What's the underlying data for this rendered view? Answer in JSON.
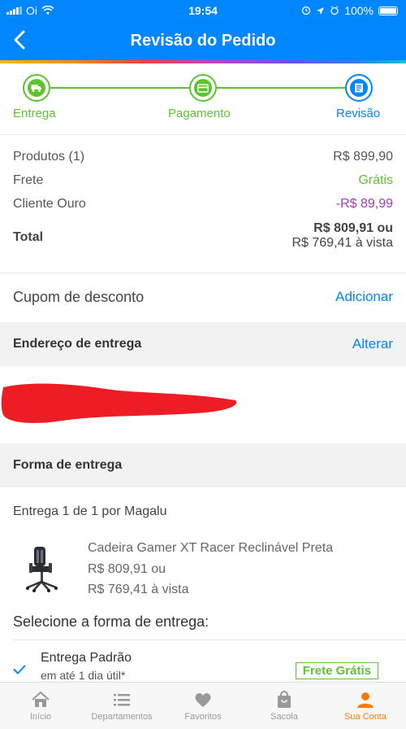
{
  "status_bar": {
    "carrier": "Oi",
    "time": "19:54",
    "battery": "100%",
    "signal_icon": "signal-bars-icon",
    "wifi_icon": "wifi-icon",
    "location_icon": "location-arrow-icon",
    "alarm_icon": "alarm-icon"
  },
  "header": {
    "title": "Revisão do Pedido",
    "back_icon": "chevron-left-icon",
    "color": "#0086ff"
  },
  "stepper": {
    "steps": [
      {
        "label": "Entrega",
        "icon": "truck-icon",
        "state": "done",
        "color": "#5ec32e"
      },
      {
        "label": "Pagamento",
        "icon": "credit-card-icon",
        "state": "done",
        "color": "#5ec32e"
      },
      {
        "label": "Revisão",
        "icon": "list-icon",
        "state": "current",
        "color": "#0086ff"
      }
    ]
  },
  "summary": {
    "products_label": "Produtos (1)",
    "products_value": "R$ 899,90",
    "shipping_label": "Frete",
    "shipping_value": "Grátis",
    "gold_label": "Cliente Ouro",
    "gold_value": "-R$ 89,99",
    "total_label": "Total",
    "total_value_line1": "R$ 809,91 ou",
    "total_value_line2": "R$ 769,41 à vista"
  },
  "coupon": {
    "label": "Cupom de desconto",
    "action": "Adicionar"
  },
  "address": {
    "title": "Endereço de entrega",
    "action": "Alterar"
  },
  "delivery": {
    "title": "Forma de entrega",
    "shipment_label": "Entrega 1 de 1",
    "shipment_by": "por Magalu",
    "product": {
      "name": "Cadeira Gamer XT Racer Reclinável Preta",
      "price_line1": "R$ 809,91 ou",
      "price_line2": "R$ 769,41 à vista",
      "image_icon": "gamer-chair-image"
    },
    "select_title": "Selecione a forma de entrega:",
    "option": {
      "name": "Entrega Padrão",
      "detail": "em até 1 dia útil*",
      "badge": "Frete Grátis",
      "selected_icon": "checkmark-icon"
    }
  },
  "tab_bar": {
    "tabs": [
      {
        "label": "Início",
        "icon": "home-icon",
        "active": false
      },
      {
        "label": "Departamentos",
        "icon": "menu-icon",
        "active": false
      },
      {
        "label": "Favoritos",
        "icon": "heart-icon",
        "active": false
      },
      {
        "label": "Sacola",
        "icon": "bag-icon",
        "active": false
      },
      {
        "label": "Sua Conta",
        "icon": "user-icon",
        "active": true
      }
    ],
    "active_color": "#ff7a00"
  },
  "colors": {
    "green": "#5ec32e",
    "purple": "#a23cb4",
    "blue": "#0086ff"
  }
}
